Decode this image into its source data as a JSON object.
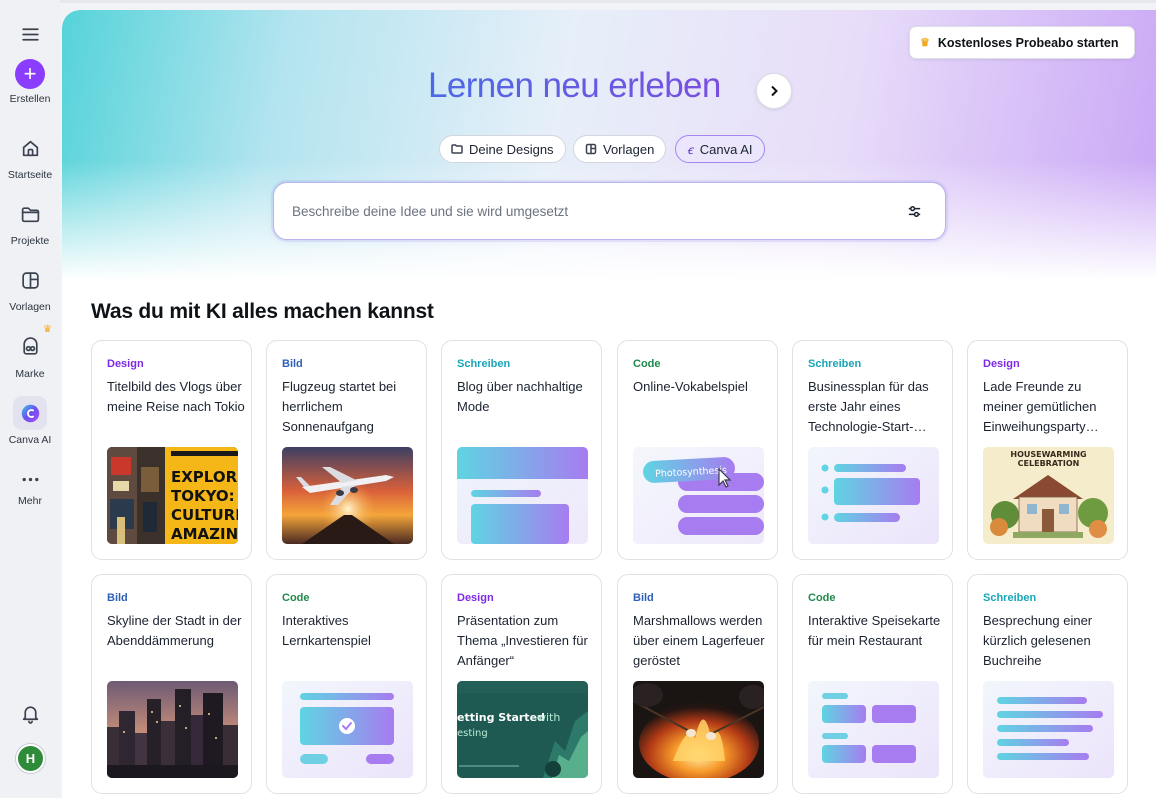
{
  "sidebar": {
    "menu_icon": "menu-icon",
    "items": [
      {
        "label": "Erstellen",
        "icon": "plus-icon"
      },
      {
        "label": "Startseite",
        "icon": "home-icon"
      },
      {
        "label": "Projekte",
        "icon": "folder-icon"
      },
      {
        "label": "Vorlagen",
        "icon": "template-icon"
      },
      {
        "label": "Marke",
        "icon": "brand-icon"
      },
      {
        "label": "Canva AI",
        "icon": "canva-ai-icon"
      },
      {
        "label": "Mehr",
        "icon": "more-icon"
      }
    ],
    "avatar_initial": "H"
  },
  "header": {
    "trial_button": "Kostenloses Probeabo starten"
  },
  "hero": {
    "title": "Lernen neu erleben",
    "pills": [
      "Deine Designs",
      "Vorlagen",
      "Canva AI"
    ],
    "search_placeholder": "Beschreibe deine Idee und sie wird umgesetzt"
  },
  "section_title": "Was du mit KI alles machen kannst",
  "cards": [
    {
      "category": "Design",
      "text": "Titelbild des Vlogs über meine Reise nach Tokio",
      "thumb_text": "EXPLORING TOKYO: FOOD, CULTURE, AMAZING EXPERIENCES"
    },
    {
      "category": "Bild",
      "text": "Flugzeug startet bei herrlichem Sonnenaufgang"
    },
    {
      "category": "Schreiben",
      "text": "Blog über nachhaltige Mode"
    },
    {
      "category": "Code",
      "text": "Online-Vokabelspiel",
      "thumb_text": "Photosynthesis"
    },
    {
      "category": "Schreiben",
      "text": "Businessplan für das erste Jahr eines Technologie-Start-…"
    },
    {
      "category": "Design",
      "text": "Lade Freunde zu meiner gemütlichen Einweihungsparty…",
      "thumb_text": "HOUSEWARMING CELEBRATION"
    },
    {
      "category": "Bild",
      "text": "Skyline der Stadt in der Abenddämmerung"
    },
    {
      "category": "Code",
      "text": "Interaktives Lernkartenspiel"
    },
    {
      "category": "Design",
      "text": "Präsentation zum Thema „Investieren für Anfänger“",
      "thumb_text": "etting Started with esting"
    },
    {
      "category": "Bild",
      "text": "Marshmallows werden über einem Lagerfeuer geröstet"
    },
    {
      "category": "Code",
      "text": "Interaktive Speisekarte für mein Restaurant"
    },
    {
      "category": "Schreiben",
      "text": "Besprechung einer kürzlich gelesenen Buchreihe"
    }
  ],
  "colors": {
    "Design": "#7d2ae8",
    "Bild": "#2e5fb8",
    "Schreiben": "#1aa5b8",
    "Code": "#1f8a4c",
    "accent": "#8b3dff"
  }
}
